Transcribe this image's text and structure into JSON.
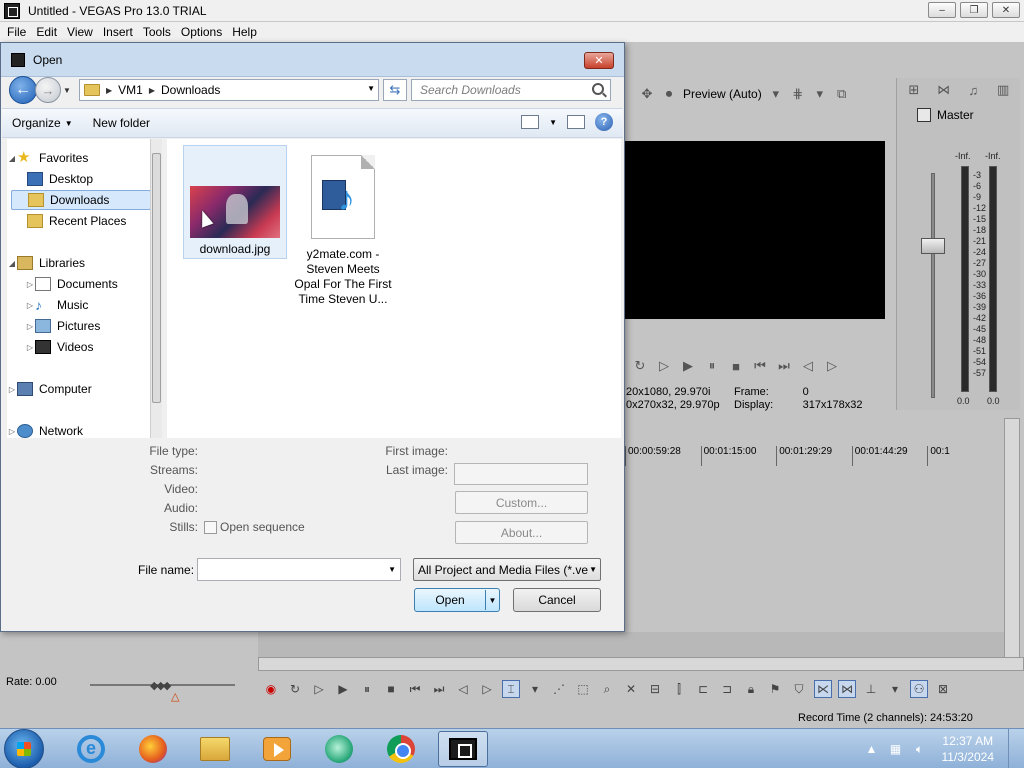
{
  "app": {
    "title": "Untitled - VEGAS Pro 13.0 TRIAL",
    "window_buttons": [
      "–",
      "❐",
      "✕"
    ],
    "menu": [
      "File",
      "Edit",
      "View",
      "Insert",
      "Tools",
      "Options",
      "Help"
    ]
  },
  "preview": {
    "mode": "Preview (Auto)",
    "info": {
      "project_line1": "20x1080, 29.970i",
      "project_line2": "0x270x32, 29.970p",
      "frame_label": "Frame:",
      "frame_value": "0",
      "display_label": "Display:",
      "display_value": "317x178x32"
    }
  },
  "mixer": {
    "master_label": "Master",
    "inf_left": "-Inf.",
    "inf_right": "-Inf.",
    "scale": [
      "3",
      "6",
      "9",
      "12",
      "15",
      "18",
      "21",
      "24",
      "27",
      "30",
      "33",
      "36",
      "39",
      "42",
      "45",
      "48",
      "51",
      "54",
      "57"
    ],
    "zero_left": "0.0",
    "zero_right": "0.0"
  },
  "timeline": {
    "ruler": [
      "00:00:59:28",
      "00:01:15:00",
      "00:01:29:29",
      "00:01:44:29",
      "00:1"
    ],
    "rate_label": "Rate: 0.00",
    "record_time": "Record Time (2 channels): 24:53:20"
  },
  "dialog": {
    "title": "Open",
    "close_label": "✕",
    "breadcrumb": [
      "VM1",
      "Downloads"
    ],
    "search_placeholder": "Search Downloads",
    "organize_label": "Organize",
    "new_folder_label": "New folder",
    "help_label": "?",
    "nav": {
      "favorites": "Favorites",
      "desktop": "Desktop",
      "downloads": "Downloads",
      "recent": "Recent Places",
      "libraries": "Libraries",
      "documents": "Documents",
      "music": "Music",
      "pictures": "Pictures",
      "videos": "Videos",
      "computer": "Computer",
      "network": "Network"
    },
    "files": [
      {
        "name": "download.jpg"
      },
      {
        "name_lines": [
          "y2mate.com -",
          "Steven Meets",
          "Opal For The First",
          "Time  Steven U..."
        ]
      }
    ],
    "details": {
      "file_type": "File type:",
      "streams": "Streams:",
      "video": "Video:",
      "audio": "Audio:",
      "stills": "Stills:",
      "open_sequence": "Open sequence",
      "first_image": "First image:",
      "last_image": "Last image:",
      "custom_btn": "Custom...",
      "about_btn": "About..."
    },
    "file_name_label": "File name:",
    "file_name_value": "",
    "file_type_value": "All Project and Media Files (*.ve",
    "open_label": "Open",
    "cancel_label": "Cancel"
  },
  "taskbar": {
    "clock_time": "12:37 AM",
    "clock_date": "11/3/2024",
    "ie_glyph": "e"
  }
}
